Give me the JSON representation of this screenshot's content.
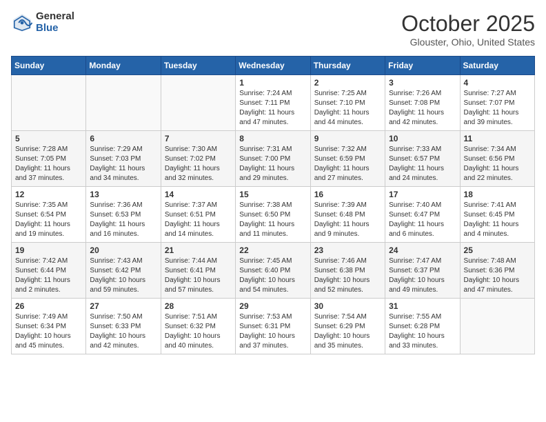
{
  "logo": {
    "general": "General",
    "blue": "Blue"
  },
  "title": "October 2025",
  "location": "Glouster, Ohio, United States",
  "weekdays": [
    "Sunday",
    "Monday",
    "Tuesday",
    "Wednesday",
    "Thursday",
    "Friday",
    "Saturday"
  ],
  "weeks": [
    [
      {
        "day": "",
        "sunrise": "",
        "sunset": "",
        "daylight": ""
      },
      {
        "day": "",
        "sunrise": "",
        "sunset": "",
        "daylight": ""
      },
      {
        "day": "",
        "sunrise": "",
        "sunset": "",
        "daylight": ""
      },
      {
        "day": "1",
        "sunrise": "Sunrise: 7:24 AM",
        "sunset": "Sunset: 7:11 PM",
        "daylight": "Daylight: 11 hours and 47 minutes."
      },
      {
        "day": "2",
        "sunrise": "Sunrise: 7:25 AM",
        "sunset": "Sunset: 7:10 PM",
        "daylight": "Daylight: 11 hours and 44 minutes."
      },
      {
        "day": "3",
        "sunrise": "Sunrise: 7:26 AM",
        "sunset": "Sunset: 7:08 PM",
        "daylight": "Daylight: 11 hours and 42 minutes."
      },
      {
        "day": "4",
        "sunrise": "Sunrise: 7:27 AM",
        "sunset": "Sunset: 7:07 PM",
        "daylight": "Daylight: 11 hours and 39 minutes."
      }
    ],
    [
      {
        "day": "5",
        "sunrise": "Sunrise: 7:28 AM",
        "sunset": "Sunset: 7:05 PM",
        "daylight": "Daylight: 11 hours and 37 minutes."
      },
      {
        "day": "6",
        "sunrise": "Sunrise: 7:29 AM",
        "sunset": "Sunset: 7:03 PM",
        "daylight": "Daylight: 11 hours and 34 minutes."
      },
      {
        "day": "7",
        "sunrise": "Sunrise: 7:30 AM",
        "sunset": "Sunset: 7:02 PM",
        "daylight": "Daylight: 11 hours and 32 minutes."
      },
      {
        "day": "8",
        "sunrise": "Sunrise: 7:31 AM",
        "sunset": "Sunset: 7:00 PM",
        "daylight": "Daylight: 11 hours and 29 minutes."
      },
      {
        "day": "9",
        "sunrise": "Sunrise: 7:32 AM",
        "sunset": "Sunset: 6:59 PM",
        "daylight": "Daylight: 11 hours and 27 minutes."
      },
      {
        "day": "10",
        "sunrise": "Sunrise: 7:33 AM",
        "sunset": "Sunset: 6:57 PM",
        "daylight": "Daylight: 11 hours and 24 minutes."
      },
      {
        "day": "11",
        "sunrise": "Sunrise: 7:34 AM",
        "sunset": "Sunset: 6:56 PM",
        "daylight": "Daylight: 11 hours and 22 minutes."
      }
    ],
    [
      {
        "day": "12",
        "sunrise": "Sunrise: 7:35 AM",
        "sunset": "Sunset: 6:54 PM",
        "daylight": "Daylight: 11 hours and 19 minutes."
      },
      {
        "day": "13",
        "sunrise": "Sunrise: 7:36 AM",
        "sunset": "Sunset: 6:53 PM",
        "daylight": "Daylight: 11 hours and 16 minutes."
      },
      {
        "day": "14",
        "sunrise": "Sunrise: 7:37 AM",
        "sunset": "Sunset: 6:51 PM",
        "daylight": "Daylight: 11 hours and 14 minutes."
      },
      {
        "day": "15",
        "sunrise": "Sunrise: 7:38 AM",
        "sunset": "Sunset: 6:50 PM",
        "daylight": "Daylight: 11 hours and 11 minutes."
      },
      {
        "day": "16",
        "sunrise": "Sunrise: 7:39 AM",
        "sunset": "Sunset: 6:48 PM",
        "daylight": "Daylight: 11 hours and 9 minutes."
      },
      {
        "day": "17",
        "sunrise": "Sunrise: 7:40 AM",
        "sunset": "Sunset: 6:47 PM",
        "daylight": "Daylight: 11 hours and 6 minutes."
      },
      {
        "day": "18",
        "sunrise": "Sunrise: 7:41 AM",
        "sunset": "Sunset: 6:45 PM",
        "daylight": "Daylight: 11 hours and 4 minutes."
      }
    ],
    [
      {
        "day": "19",
        "sunrise": "Sunrise: 7:42 AM",
        "sunset": "Sunset: 6:44 PM",
        "daylight": "Daylight: 11 hours and 2 minutes."
      },
      {
        "day": "20",
        "sunrise": "Sunrise: 7:43 AM",
        "sunset": "Sunset: 6:42 PM",
        "daylight": "Daylight: 10 hours and 59 minutes."
      },
      {
        "day": "21",
        "sunrise": "Sunrise: 7:44 AM",
        "sunset": "Sunset: 6:41 PM",
        "daylight": "Daylight: 10 hours and 57 minutes."
      },
      {
        "day": "22",
        "sunrise": "Sunrise: 7:45 AM",
        "sunset": "Sunset: 6:40 PM",
        "daylight": "Daylight: 10 hours and 54 minutes."
      },
      {
        "day": "23",
        "sunrise": "Sunrise: 7:46 AM",
        "sunset": "Sunset: 6:38 PM",
        "daylight": "Daylight: 10 hours and 52 minutes."
      },
      {
        "day": "24",
        "sunrise": "Sunrise: 7:47 AM",
        "sunset": "Sunset: 6:37 PM",
        "daylight": "Daylight: 10 hours and 49 minutes."
      },
      {
        "day": "25",
        "sunrise": "Sunrise: 7:48 AM",
        "sunset": "Sunset: 6:36 PM",
        "daylight": "Daylight: 10 hours and 47 minutes."
      }
    ],
    [
      {
        "day": "26",
        "sunrise": "Sunrise: 7:49 AM",
        "sunset": "Sunset: 6:34 PM",
        "daylight": "Daylight: 10 hours and 45 minutes."
      },
      {
        "day": "27",
        "sunrise": "Sunrise: 7:50 AM",
        "sunset": "Sunset: 6:33 PM",
        "daylight": "Daylight: 10 hours and 42 minutes."
      },
      {
        "day": "28",
        "sunrise": "Sunrise: 7:51 AM",
        "sunset": "Sunset: 6:32 PM",
        "daylight": "Daylight: 10 hours and 40 minutes."
      },
      {
        "day": "29",
        "sunrise": "Sunrise: 7:53 AM",
        "sunset": "Sunset: 6:31 PM",
        "daylight": "Daylight: 10 hours and 37 minutes."
      },
      {
        "day": "30",
        "sunrise": "Sunrise: 7:54 AM",
        "sunset": "Sunset: 6:29 PM",
        "daylight": "Daylight: 10 hours and 35 minutes."
      },
      {
        "day": "31",
        "sunrise": "Sunrise: 7:55 AM",
        "sunset": "Sunset: 6:28 PM",
        "daylight": "Daylight: 10 hours and 33 minutes."
      },
      {
        "day": "",
        "sunrise": "",
        "sunset": "",
        "daylight": ""
      }
    ]
  ]
}
